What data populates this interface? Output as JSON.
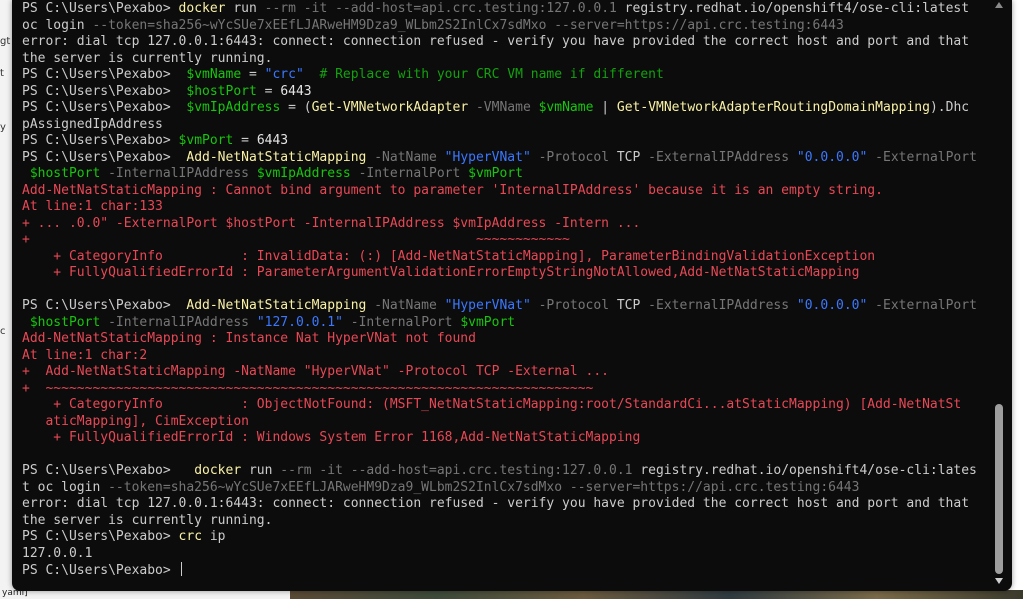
{
  "side_text": [
    "gt",
    "t",
    "y",
    "c"
  ],
  "bottom_stub": "yaml]",
  "prompt": "PS C:\\Users\\Pexabo>",
  "colors": {
    "background": "#0c0c0c",
    "text": "#cccccc",
    "command": "#f9f1a5",
    "parameter": "#767676",
    "variable": "#16c60c",
    "string": "#3b78ff",
    "comment": "#13a10e",
    "error": "#e74856"
  },
  "lines": [
    [
      {
        "t": "PS C:\\Users\\Pexabo> ",
        "c": "plain"
      },
      {
        "t": "docker",
        "c": "cmd"
      },
      {
        "t": " run ",
        "c": "plain"
      },
      {
        "t": "--rm -it --add-host=api.crc.testing:127.0.0.1",
        "c": "param"
      },
      {
        "t": " registry.redhat.io/openshift4/ose-cli:latest",
        "c": "plain"
      }
    ],
    [
      {
        "t": "oc login ",
        "c": "plain"
      },
      {
        "t": "--token=sha256~wYcSUe7xEEfLJARweHM9Dza9_WLbm2S2InlCx7sdMxo --server=https://api.crc.testing:6443",
        "c": "param"
      }
    ],
    [
      {
        "t": "error: dial tcp 127.0.0.1:6443: connect: connection refused - verify you have provided the correct host and port and that",
        "c": "plain"
      }
    ],
    [
      {
        "t": "the server is currently running.",
        "c": "plain"
      }
    ],
    [
      {
        "t": "PS C:\\Users\\Pexabo>  ",
        "c": "plain"
      },
      {
        "t": "$vmName",
        "c": "var"
      },
      {
        "t": " = ",
        "c": "plain"
      },
      {
        "t": "\"crc\"",
        "c": "str"
      },
      {
        "t": "  # Replace with your CRC VM name if different",
        "c": "cmt"
      }
    ],
    [
      {
        "t": "PS C:\\Users\\Pexabo>  ",
        "c": "plain"
      },
      {
        "t": "$hostPort",
        "c": "var"
      },
      {
        "t": " = ",
        "c": "plain"
      },
      {
        "t": "6443",
        "c": "num"
      }
    ],
    [
      {
        "t": "PS C:\\Users\\Pexabo>  ",
        "c": "plain"
      },
      {
        "t": "$vmIpAddress",
        "c": "var"
      },
      {
        "t": " = (",
        "c": "plain"
      },
      {
        "t": "Get-VMNetworkAdapter",
        "c": "cmd"
      },
      {
        "t": " -VMName ",
        "c": "param"
      },
      {
        "t": "$vmName",
        "c": "var"
      },
      {
        "t": " | ",
        "c": "plain"
      },
      {
        "t": "Get-VMNetworkAdapterRoutingDomainMapping",
        "c": "cmd"
      },
      {
        "t": ").Dhc",
        "c": "plain"
      }
    ],
    [
      {
        "t": "pAssignedIpAddress",
        "c": "plain"
      }
    ],
    [
      {
        "t": "PS C:\\Users\\Pexabo> ",
        "c": "plain"
      },
      {
        "t": "$vmPort",
        "c": "var"
      },
      {
        "t": " = ",
        "c": "plain"
      },
      {
        "t": "6443",
        "c": "num"
      }
    ],
    [
      {
        "t": "PS C:\\Users\\Pexabo>  ",
        "c": "plain"
      },
      {
        "t": "Add-NetNatStaticMapping",
        "c": "cmd"
      },
      {
        "t": " -NatName ",
        "c": "param"
      },
      {
        "t": "\"HyperVNat\"",
        "c": "str"
      },
      {
        "t": " -Protocol ",
        "c": "param"
      },
      {
        "t": "TCP",
        "c": "plain"
      },
      {
        "t": " -ExternalIPAddress ",
        "c": "param"
      },
      {
        "t": "\"0.0.0.0\"",
        "c": "str"
      },
      {
        "t": " -ExternalPort",
        "c": "param"
      }
    ],
    [
      {
        "t": " ",
        "c": "plain"
      },
      {
        "t": "$hostPort",
        "c": "var"
      },
      {
        "t": " -InternalIPAddress ",
        "c": "param"
      },
      {
        "t": "$vmIpAddress",
        "c": "var"
      },
      {
        "t": " -InternalPort ",
        "c": "param"
      },
      {
        "t": "$vmPort",
        "c": "var"
      }
    ],
    [
      {
        "t": "Add-NetNatStaticMapping : Cannot bind argument to parameter 'InternalIPAddress' because it is an empty string.",
        "c": "err"
      }
    ],
    [
      {
        "t": "At line:1 char:133",
        "c": "err"
      }
    ],
    [
      {
        "t": "+ ... .0.0\" -ExternalPort $hostPort -InternalIPAddress $vmIpAddress -Intern ...",
        "c": "err"
      }
    ],
    [
      {
        "t": "+                                                         ~~~~~~~~~~~~",
        "c": "err"
      }
    ],
    [
      {
        "t": "    + CategoryInfo          : InvalidData: (:) [Add-NetNatStaticMapping], ParameterBindingValidationException",
        "c": "err"
      }
    ],
    [
      {
        "t": "    + FullyQualifiedErrorId : ParameterArgumentValidationErrorEmptyStringNotAllowed,Add-NetNatStaticMapping",
        "c": "err"
      }
    ],
    [
      {
        "t": "",
        "c": "plain"
      }
    ],
    [
      {
        "t": "PS C:\\Users\\Pexabo>  ",
        "c": "plain"
      },
      {
        "t": "Add-NetNatStaticMapping",
        "c": "cmd"
      },
      {
        "t": " -NatName ",
        "c": "param"
      },
      {
        "t": "\"HyperVNat\"",
        "c": "str"
      },
      {
        "t": " -Protocol ",
        "c": "param"
      },
      {
        "t": "TCP",
        "c": "plain"
      },
      {
        "t": " -ExternalIPAddress ",
        "c": "param"
      },
      {
        "t": "\"0.0.0.0\"",
        "c": "str"
      },
      {
        "t": " -ExternalPort",
        "c": "param"
      }
    ],
    [
      {
        "t": " ",
        "c": "plain"
      },
      {
        "t": "$hostPort",
        "c": "var"
      },
      {
        "t": " -InternalIPAddress ",
        "c": "param"
      },
      {
        "t": "\"127.0.0.1\"",
        "c": "str"
      },
      {
        "t": " -InternalPort ",
        "c": "param"
      },
      {
        "t": "$vmPort",
        "c": "var"
      }
    ],
    [
      {
        "t": "Add-NetNatStaticMapping : Instance Nat HyperVNat not found",
        "c": "err"
      }
    ],
    [
      {
        "t": "At line:1 char:2",
        "c": "err"
      }
    ],
    [
      {
        "t": "+  Add-NetNatStaticMapping -NatName \"HyperVNat\" -Protocol TCP -External ...",
        "c": "err"
      }
    ],
    [
      {
        "t": "+  ~~~~~~~~~~~~~~~~~~~~~~~~~~~~~~~~~~~~~~~~~~~~~~~~~~~~~~~~~~~~~~~~~~~~~~",
        "c": "err"
      }
    ],
    [
      {
        "t": "    + CategoryInfo          : ObjectNotFound: (MSFT_NetNatStaticMapping:root/StandardCi...atStaticMapping) [Add-NetNatSt",
        "c": "err"
      }
    ],
    [
      {
        "t": "   aticMapping], CimException",
        "c": "err"
      }
    ],
    [
      {
        "t": "    + FullyQualifiedErrorId : Windows System Error 1168,Add-NetNatStaticMapping",
        "c": "err"
      }
    ],
    [
      {
        "t": "",
        "c": "plain"
      }
    ],
    [
      {
        "t": "PS C:\\Users\\Pexabo>   ",
        "c": "plain"
      },
      {
        "t": "docker",
        "c": "cmd"
      },
      {
        "t": " run ",
        "c": "plain"
      },
      {
        "t": "--rm -it --add-host=api.crc.testing:127.0.0.1",
        "c": "param"
      },
      {
        "t": " registry.redhat.io/openshift4/ose-cli:lates",
        "c": "plain"
      }
    ],
    [
      {
        "t": "t oc login ",
        "c": "plain"
      },
      {
        "t": "--token=sha256~wYcSUe7xEEfLJARweHM9Dza9_WLbm2S2InlCx7sdMxo --server=https://api.crc.testing:6443",
        "c": "param"
      }
    ],
    [
      {
        "t": "error: dial tcp 127.0.0.1:6443: connect: connection refused - verify you have provided the correct host and port and that",
        "c": "plain"
      }
    ],
    [
      {
        "t": "the server is currently running.",
        "c": "plain"
      }
    ],
    [
      {
        "t": "PS C:\\Users\\Pexabo> ",
        "c": "plain"
      },
      {
        "t": "crc",
        "c": "cmd"
      },
      {
        "t": " ip",
        "c": "plain"
      }
    ],
    [
      {
        "t": "127.0.0.1",
        "c": "plain"
      }
    ],
    [
      {
        "t": "PS C:\\Users\\Pexabo> ",
        "c": "plain"
      }
    ]
  ]
}
